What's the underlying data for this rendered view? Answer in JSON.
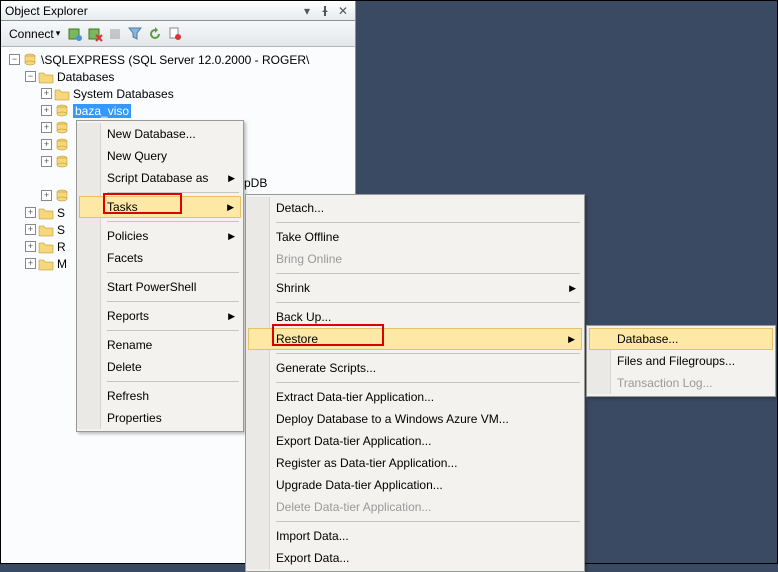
{
  "panel": {
    "title": "Object Explorer"
  },
  "toolbar": {
    "connect": "Connect"
  },
  "tree": {
    "server": "\\SQLEXPRESS (SQL Server 12.0.2000 - ROGER\\",
    "databases": "Databases",
    "system_db": "System Databases",
    "selected_db": "baza_viso",
    "partial_s": "S",
    "partial_s2": "S",
    "partial_re": "R",
    "partial_m": "M",
    "behind_label": "pDB"
  },
  "menu1": {
    "new_database": "New Database...",
    "new_query": "New Query",
    "script_db": "Script Database as",
    "tasks": "Tasks",
    "policies": "Policies",
    "facets": "Facets",
    "start_ps": "Start PowerShell",
    "reports": "Reports",
    "rename": "Rename",
    "delete": "Delete",
    "refresh": "Refresh",
    "properties": "Properties"
  },
  "menu2": {
    "detach": "Detach...",
    "take_offline": "Take Offline",
    "bring_online": "Bring Online",
    "shrink": "Shrink",
    "back_up": "Back Up...",
    "restore": "Restore",
    "gen_scripts": "Generate Scripts...",
    "extract_dt": "Extract Data-tier Application...",
    "deploy_azure": "Deploy Database to a Windows Azure VM...",
    "export_dt": "Export Data-tier Application...",
    "register_dt": "Register as Data-tier Application...",
    "upgrade_dt": "Upgrade Data-tier Application...",
    "delete_dt": "Delete Data-tier Application...",
    "import_data": "Import Data...",
    "export_data": "Export Data..."
  },
  "menu3": {
    "database": "Database...",
    "files_fg": "Files and Filegroups...",
    "transaction_log": "Transaction Log..."
  }
}
